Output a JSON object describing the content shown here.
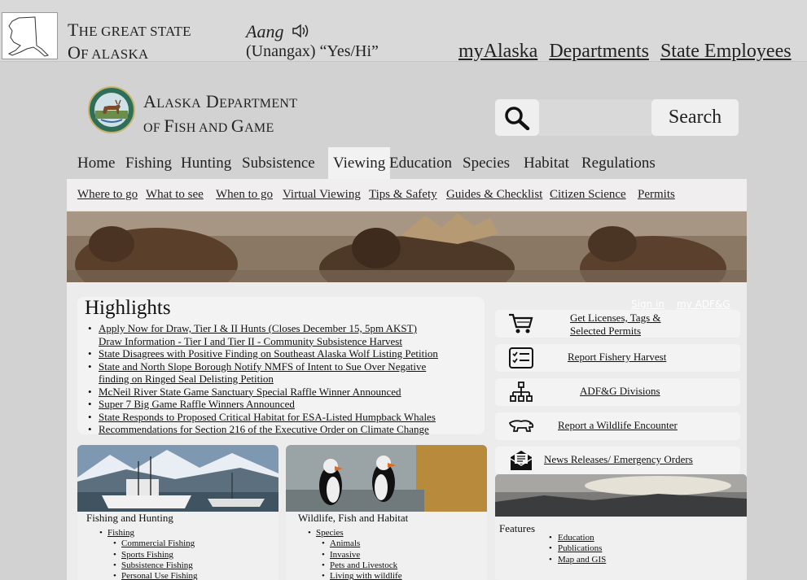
{
  "state": {
    "title_line1_big": "T",
    "title_line1_small": "HE GREAT STATE",
    "title_line2_big": "O",
    "title_line2_small": "F ALASKA",
    "aang_word": "Aang",
    "aang_translation": "(Unangax) “Yes/Hi”",
    "nav": [
      "myAlaska",
      "Departments",
      "State Employees"
    ]
  },
  "dept": {
    "name_line1": [
      {
        "big": "A",
        "small": "LASKA"
      },
      {
        "big": "D",
        "small": "EPARTMENT"
      }
    ],
    "name_line2": [
      {
        "big": "",
        "small": "OF "
      },
      {
        "big": "F",
        "small": "ISH AND "
      },
      {
        "big": "G",
        "small": "AME"
      }
    ]
  },
  "search": {
    "placeholder": "",
    "button_label": "Search"
  },
  "mainnav": {
    "items": [
      "Home",
      "Fishing",
      "Hunting",
      "Subsistence",
      "Viewing",
      "Education",
      "Species",
      "Habitat",
      "Regulations"
    ],
    "active": "Viewing"
  },
  "subnav": {
    "items": [
      "Where to go",
      "What to see",
      "When to go",
      "Virtual Viewing",
      "Tips & Safety",
      "Guides & Checklist",
      "Citizen Science",
      "Permits"
    ]
  },
  "account": {
    "sign_in": "Sign in",
    "my_adfg": "my ADF&G"
  },
  "highlights": {
    "title": "Highlights",
    "items": [
      {
        "text": "Apply Now for Draw, Tier I & II Hunts (Closes December 15, 5pm AKST)",
        "sub": "Draw Information - Tier I and Tier II - Community Subsistence Harvest"
      },
      {
        "text": "State Disagrees with Positive Finding on Southeast Alaska Wolf Listing Petition",
        "sub": ""
      },
      {
        "text": "State and North Slope Borough Notify NMFS of Intent to Sue Over Negative",
        "sub": "finding on Ringed Seal Delisting Petition"
      },
      {
        "text": "McNeil River State Game Sanctuary Special Raffle Winner Announced",
        "sub": ""
      },
      {
        "text": "Super 7 Big Game Raffle Winners Announced",
        "sub": ""
      },
      {
        "text": "State Responds to Proposed Critical Habitat for ESA-Listed Humpback Whales",
        "sub": ""
      },
      {
        "text": "Recommendations for Section 216 of the Executive Order on Climate Change",
        "sub": ""
      }
    ]
  },
  "actions": [
    {
      "label_line1": "Get Licenses, Tags &",
      "label_line2": "Selected Permits",
      "icon": "shopping-cart-icon"
    },
    {
      "label_line1": "Report Fishery Harvest",
      "label_line2": "",
      "icon": "checklist-icon"
    },
    {
      "label_line1": "ADF&G Divisions",
      "label_line2": "",
      "icon": "org-chart-icon"
    },
    {
      "label_line1": "Report a Wildlife Encounter",
      "label_line2": "",
      "icon": "polar-bear-icon"
    },
    {
      "label_line1": "News Releases/ Emergency Orders",
      "label_line2": "",
      "icon": "mail-icon"
    }
  ],
  "cards": [
    {
      "title": "Fishing and Hunting",
      "top_item": "Fishing",
      "sub_items": [
        "Commercial Fishing",
        "Sports Fishing",
        "Subsistence Fishing",
        "Personal Use Fishing"
      ]
    },
    {
      "title": "Wildlife, Fish and Habitat",
      "top_item": "Species",
      "sub_items": [
        "Animals",
        "Invasive",
        "Pets and Livestock",
        "Living with wildlife"
      ]
    }
  ],
  "features": {
    "title": "Features",
    "items": [
      "Education",
      "Publications",
      "Map and GIS"
    ]
  }
}
